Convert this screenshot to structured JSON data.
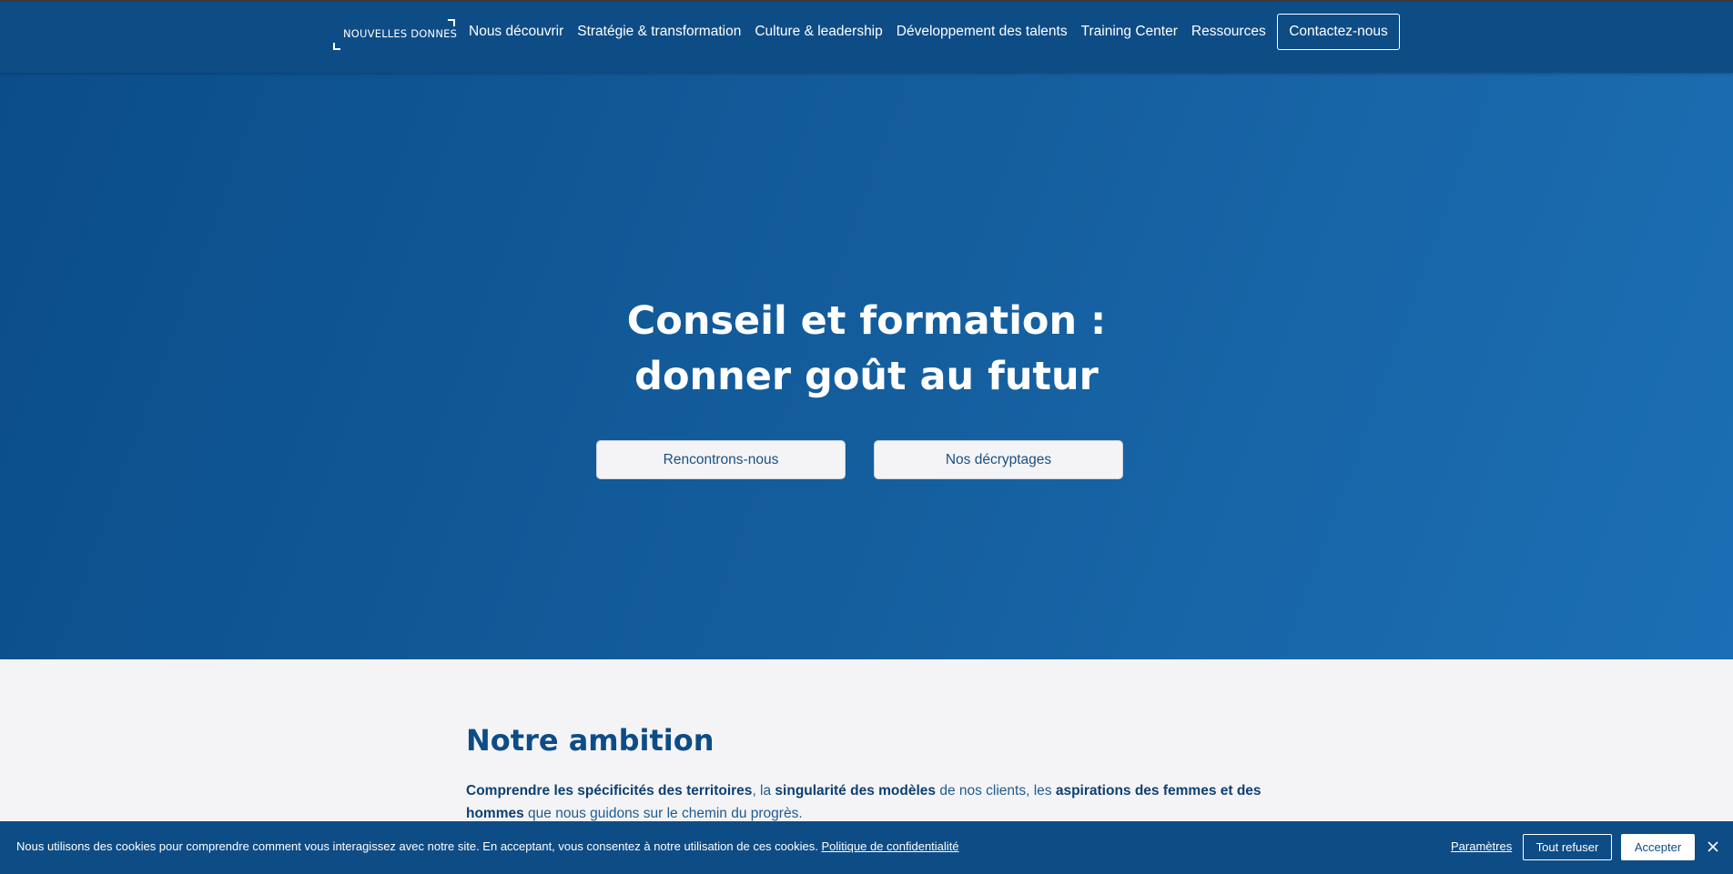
{
  "header": {
    "logo_text": "NOUVELLES DONNES",
    "nav": [
      {
        "label": "Nous découvrir"
      },
      {
        "label": "Stratégie & transformation"
      },
      {
        "label": "Culture & leadership"
      },
      {
        "label": "Développement des talents"
      },
      {
        "label": "Training Center"
      },
      {
        "label": "Ressources"
      }
    ],
    "contact_label": "Contactez-nous"
  },
  "hero": {
    "title_line1": "Conseil et formation :",
    "title_line2": "donner goût au futur",
    "button_meet": "Rencontrons-nous",
    "button_insights": "Nos décryptages"
  },
  "ambition": {
    "title": "Notre ambition",
    "text_parts": [
      {
        "text": "Comprendre les spécificités des territoires",
        "bold": true
      },
      {
        "text": ", la ",
        "bold": false
      },
      {
        "text": "singularité des modèles",
        "bold": true
      },
      {
        "text": " de nos clients, les ",
        "bold": false
      },
      {
        "text": "aspirations des femmes et des hommes",
        "bold": true
      },
      {
        "text": " que nous guidons sur le chemin du progrès.",
        "bold": false
      }
    ]
  },
  "cookies": {
    "message": "Nous utilisons des cookies pour comprendre comment vous interagissez avec notre site. En acceptant, vous consentez à notre utilisation de ces cookies.",
    "policy_link": "Politique de confidentialité",
    "settings": "Paramètres",
    "refuse": "Tout refuser",
    "accept": "Accepter"
  },
  "colors": {
    "brand_blue": "#0e4c86",
    "hero_light": "#1c6fb5",
    "background": "#f4f4f6"
  },
  "icons": {
    "close": "close-icon"
  }
}
